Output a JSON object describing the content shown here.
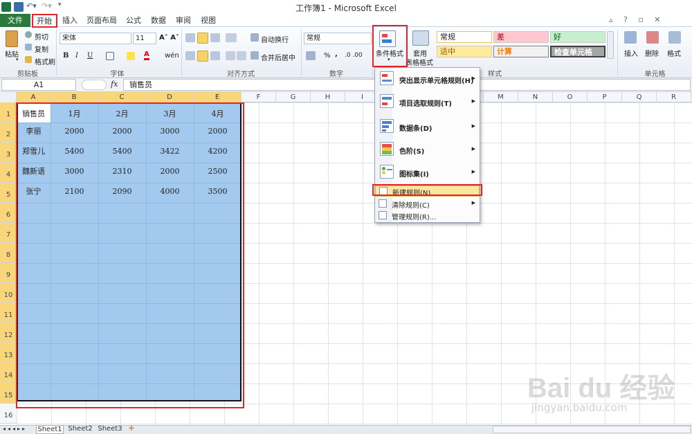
{
  "window": {
    "title": "工作簿1 - Microsoft Excel"
  },
  "tabs": {
    "file": "文件",
    "home": "开始",
    "items": [
      "插入",
      "页面布局",
      "公式",
      "数据",
      "审阅",
      "视图"
    ]
  },
  "clipboard": {
    "paste": "粘贴",
    "cut": "剪切",
    "copy": "复制",
    "format_painter": "格式刷",
    "label": "剪贴板"
  },
  "font": {
    "name": "宋体",
    "size": "11",
    "bold": "B",
    "italic": "I",
    "underline": "U",
    "font_color": "A",
    "phonetic": "wén",
    "label": "字体"
  },
  "alignment": {
    "wrap": "自动换行",
    "merge": "合并后居中",
    "label": "对齐方式"
  },
  "number": {
    "format": "常规",
    "percent": "%",
    "comma": ",",
    "label": "数字"
  },
  "styles": {
    "conditional_format": "条件格式",
    "table_format_1": "套用",
    "table_format_2": "表格格式",
    "label": "样式",
    "cells": [
      {
        "text": "常规"
      },
      {
        "text": "差"
      },
      {
        "text": "好"
      },
      {
        "text": "适中"
      },
      {
        "text": "计算"
      },
      {
        "text": "检查单元格"
      }
    ]
  },
  "cells_group": {
    "insert": "插入",
    "delete": "删除",
    "format": "格式",
    "label": "单元格"
  },
  "formula_bar": {
    "name_box": "A1",
    "fx": "fx",
    "content": "销售员"
  },
  "columns": [
    "A",
    "B",
    "C",
    "D",
    "E",
    "F",
    "G",
    "H",
    "I",
    "J",
    "K",
    "L",
    "M",
    "N",
    "O",
    "P",
    "Q",
    "R"
  ],
  "rows": [
    "1",
    "2",
    "3",
    "4",
    "5",
    "6",
    "7",
    "8",
    "9",
    "10",
    "11",
    "12",
    "13",
    "14",
    "15",
    "16"
  ],
  "table": [
    [
      "销售员",
      "1月",
      "2月",
      "3月",
      "4月"
    ],
    [
      "李丽",
      "2000",
      "2000",
      "3000",
      "2000"
    ],
    [
      "郑雪儿",
      "5400",
      "5400",
      "3422",
      "4200"
    ],
    [
      "魏新语",
      "3000",
      "2310",
      "2000",
      "2500"
    ],
    [
      "张宁",
      "2100",
      "2090",
      "4000",
      "3500"
    ]
  ],
  "sheets": [
    "Sheet1",
    "Sheet2",
    "Sheet3"
  ],
  "menu": {
    "items": [
      {
        "label": "突出显示单元格规则(H)"
      },
      {
        "label": "项目选取规则(T)"
      },
      {
        "label": "数据条(D)"
      },
      {
        "label": "色阶(S)"
      },
      {
        "label": "图标集(I)"
      }
    ],
    "small": [
      {
        "label": "新建规则(N)..."
      },
      {
        "label": "清除规则(C)"
      },
      {
        "label": "管理规则(R)..."
      }
    ]
  },
  "watermark": {
    "brand": "Bai du 经验",
    "url": "jingyan.baidu.com"
  }
}
